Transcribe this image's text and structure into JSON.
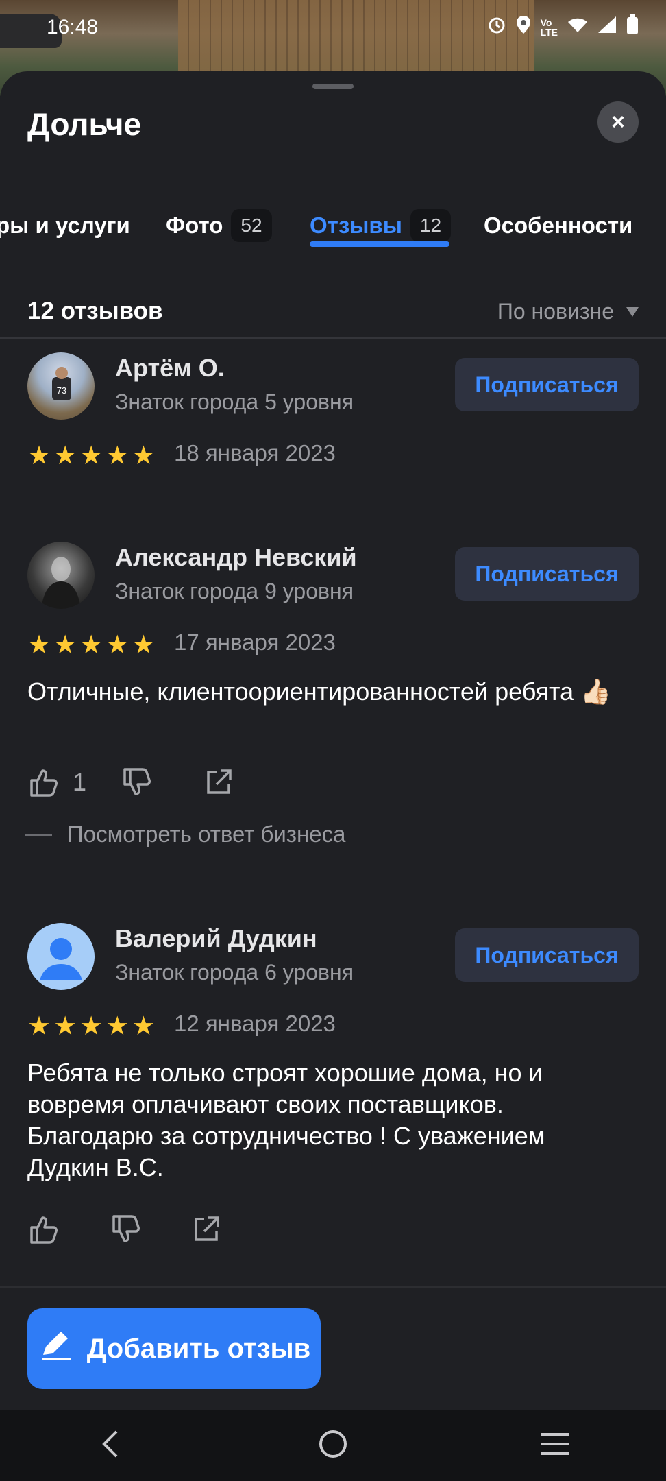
{
  "status_bar": {
    "time": "16:48"
  },
  "header": {
    "title": "Дольче",
    "close_symbol": "×"
  },
  "tabs": [
    {
      "label": "ры и услуги",
      "count": ""
    },
    {
      "label": "Фото",
      "count": "52"
    },
    {
      "label": "Отзывы",
      "count": "12",
      "active": true
    },
    {
      "label": "Особенности",
      "count": ""
    }
  ],
  "reviews_header": {
    "count_label": "12 отзывов",
    "sort_label": "По новизне"
  },
  "reviews": [
    {
      "name": "Артём О.",
      "level": "Знаток города 5 уровня",
      "rating": 5,
      "date": "18 января 2023",
      "subscribe_label": "Подписаться",
      "text": "",
      "likes": ""
    },
    {
      "name": "Александр Невский",
      "level": "Знаток города 9 уровня",
      "rating": 5,
      "date": "17 января 2023",
      "subscribe_label": "Подписаться",
      "text": "Отличные, клиентоориентированностей ребята 👍🏻",
      "likes": "1",
      "answer_label": "Посмотреть ответ бизнеса"
    },
    {
      "name": "Валерий Дудкин",
      "level": "Знаток города 6 уровня",
      "rating": 5,
      "date": "12 января 2023",
      "subscribe_label": "Подписаться",
      "text": "Ребята не только строят хорошие дома, но и вовремя оплачивают своих поставщиков. Благодарю за сотрудничество ! С уважением Дудкин В.С.",
      "likes": ""
    }
  ],
  "add_review_label": "Добавить отзыв",
  "colors": {
    "accent": "#2f7cf6",
    "star": "#ffc932",
    "background": "#1f2024"
  },
  "icons": [
    "alarm-icon",
    "location-icon",
    "volte-icon",
    "wifi-icon",
    "signal-icon",
    "battery-icon",
    "close-icon",
    "sort-arrow-icon",
    "star-icon",
    "like-icon",
    "dislike-icon",
    "share-icon",
    "pencil-icon",
    "back-icon",
    "home-icon",
    "recents-icon"
  ]
}
